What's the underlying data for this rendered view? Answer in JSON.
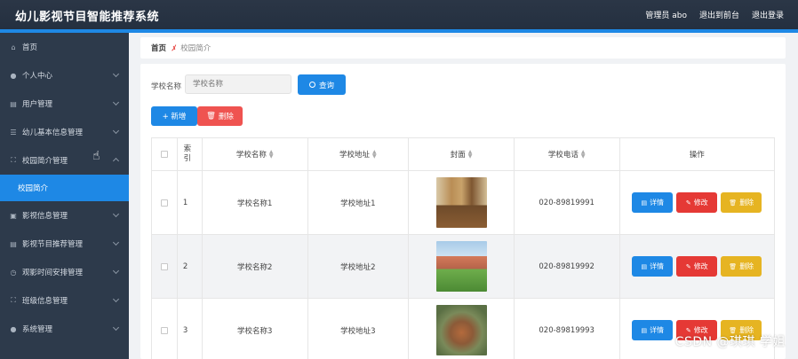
{
  "header": {
    "app_title": "幼儿影视节目智能推荐系统",
    "user_label": "管理员 abo",
    "to_front_label": "退出到前台",
    "logout_label": "退出登录"
  },
  "sidebar": {
    "items": [
      {
        "label": "首页",
        "icon": "home-icon"
      },
      {
        "label": "个人中心",
        "icon": "user-icon"
      },
      {
        "label": "用户管理",
        "icon": "clipboard-icon"
      },
      {
        "label": "幼儿基本信息管理",
        "icon": "list-icon"
      },
      {
        "label": "校园简介管理",
        "icon": "frame-icon"
      },
      {
        "label": "影视信息管理",
        "icon": "card-icon"
      },
      {
        "label": "影视节目推荐管理",
        "icon": "clipboard-icon"
      },
      {
        "label": "观影时间安排管理",
        "icon": "clock-icon"
      },
      {
        "label": "班级信息管理",
        "icon": "frame-icon"
      },
      {
        "label": "系统管理",
        "icon": "pin-icon"
      }
    ],
    "active_sub": "校园简介"
  },
  "breadcrumb": {
    "home": "首页",
    "current": "校园简介"
  },
  "search": {
    "label": "学校名称",
    "placeholder": "学校名称",
    "button_label": "查询"
  },
  "toolbar": {
    "add_label": "+ 新增",
    "delete_label": "删除"
  },
  "table": {
    "headers": {
      "index": "索引",
      "name": "学校名称",
      "address": "学校地址",
      "cover": "封面",
      "phone": "学校电话",
      "actions": "操作"
    },
    "rows": [
      {
        "index": "1",
        "name": "学校名称1",
        "address": "学校地址1",
        "phone": "020-89819991"
      },
      {
        "index": "2",
        "name": "学校名称2",
        "address": "学校地址2",
        "phone": "020-89819992"
      },
      {
        "index": "3",
        "name": "学校名称3",
        "address": "学校地址3",
        "phone": "020-89819993"
      }
    ],
    "row_actions": {
      "detail": "详情",
      "edit": "修改",
      "remove": "删除"
    }
  },
  "watermark": "CSDN @琪琪 学姐",
  "colors": {
    "header_bg": "#2b3646",
    "sidebar_bg": "#2d3a4b",
    "primary": "#1e88e5",
    "danger": "#e53935",
    "warning": "#e6b422"
  }
}
